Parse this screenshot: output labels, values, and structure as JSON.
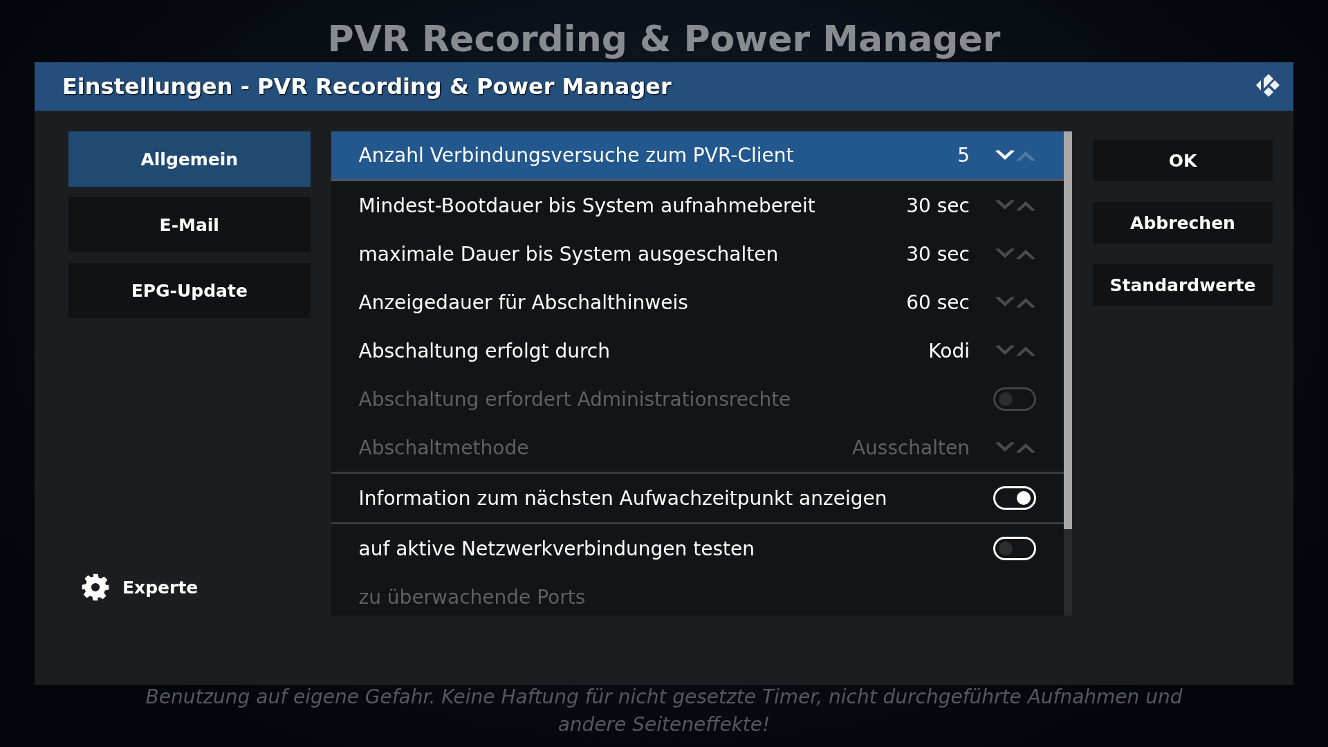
{
  "page_title": "PVR Recording & Power Manager",
  "dialog": {
    "title": "Einstellungen - PVR Recording & Power Manager"
  },
  "categories": [
    {
      "label": "Allgemein",
      "selected": true
    },
    {
      "label": "E-Mail",
      "selected": false
    },
    {
      "label": "EPG-Update",
      "selected": false
    }
  ],
  "level_button": {
    "label": "Experte"
  },
  "settings": [
    {
      "kind": "spinner",
      "label": "Anzahl Verbindungsversuche zum PVR-Client",
      "value": "5",
      "selected": true,
      "disabled": false,
      "divider_below": false
    },
    {
      "kind": "spinner",
      "label": "Mindest-Bootdauer bis System aufnahmebereit",
      "value": "30 sec",
      "selected": false,
      "disabled": false,
      "divider_below": false
    },
    {
      "kind": "spinner",
      "label": "maximale Dauer bis System ausgeschalten",
      "value": "30 sec",
      "selected": false,
      "disabled": false,
      "divider_below": false
    },
    {
      "kind": "spinner",
      "label": "Anzeigedauer für Abschalthinweis",
      "value": "60 sec",
      "selected": false,
      "disabled": false,
      "divider_below": false
    },
    {
      "kind": "spinner",
      "label": "Abschaltung erfolgt durch",
      "value": "Kodi",
      "selected": false,
      "disabled": false,
      "divider_below": false
    },
    {
      "kind": "toggle",
      "label": "Abschaltung erfordert Administrationsrechte",
      "on": false,
      "selected": false,
      "disabled": true,
      "divider_below": false
    },
    {
      "kind": "spinner",
      "label": "Abschaltmethode",
      "value": "Ausschalten",
      "selected": false,
      "disabled": true,
      "divider_below": true
    },
    {
      "kind": "toggle",
      "label": "Information zum nächsten Aufwachzeitpunkt anzeigen",
      "on": true,
      "selected": false,
      "disabled": false,
      "divider_below": true
    },
    {
      "kind": "toggle",
      "label": "auf aktive Netzwerkverbindungen testen",
      "on": false,
      "selected": false,
      "disabled": false,
      "divider_below": false
    },
    {
      "kind": "edit",
      "label": "zu überwachende Ports",
      "selected": false,
      "disabled": true,
      "divider_below": false
    }
  ],
  "buttons": [
    {
      "label": "OK"
    },
    {
      "label": "Abbrechen"
    },
    {
      "label": "Standardwerte"
    }
  ],
  "footer_note": "Benutzung auf eigene Gefahr. Keine Haftung für nicht gesetzte Timer, nicht durchgeführte Aufnahmen und andere Seiteneffekte!"
}
